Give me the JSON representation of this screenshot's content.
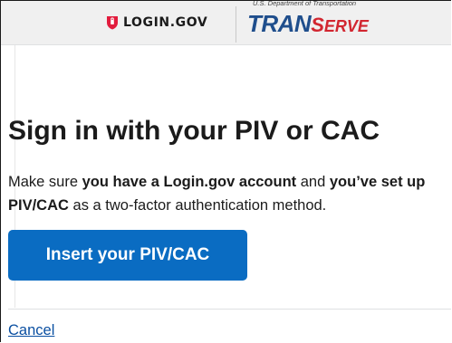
{
  "header": {
    "login_logo_text": "LOGIN.GOV",
    "partner_dept_text": "U.S. Department of Transportation",
    "partner_brand_part1": "TRAN",
    "partner_brand_part2_cap": "S",
    "partner_brand_part2_rest": "ERVE"
  },
  "main": {
    "title": "Sign in with your PIV or CAC",
    "desc_part1": "Make sure ",
    "desc_bold1": "you have a Login.gov account",
    "desc_part2": " and ",
    "desc_bold2": "you’ve set up PIV/CAC",
    "desc_part3": " as a two-factor authentication method.",
    "insert_button_label": "Insert your PIV/CAC",
    "cancel_link_label": "Cancel"
  },
  "colors": {
    "primary_button": "#0a6cc2",
    "link": "#0a4fa1",
    "logo_shield": "#e21c3d",
    "transerve_blue": "#1f4e8c",
    "transerve_red": "#d22630"
  },
  "icons": {
    "login_shield": "shield-icon"
  }
}
